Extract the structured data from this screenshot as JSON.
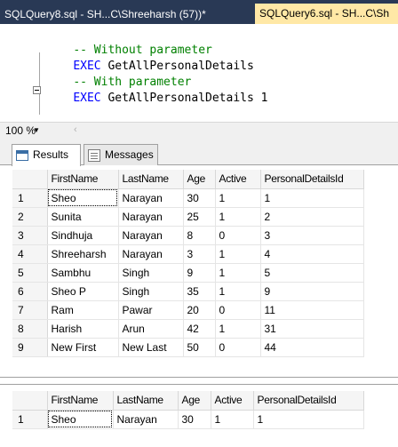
{
  "tabs": [
    {
      "label": "SQLQuery8.sql - SH...C\\Shreeharsh (57))*",
      "active": false
    },
    {
      "label": "SQLQuery6.sql - SH...C\\Sh",
      "active": true
    }
  ],
  "editor": {
    "lines": [
      {
        "keyword": "",
        "rest": "-- Without parameter",
        "comment": true
      },
      {
        "keyword": "EXEC",
        "rest": " GetAllPersonalDetails",
        "comment": false
      },
      {
        "keyword": "",
        "rest": "-- With parameter",
        "comment": true
      },
      {
        "keyword": "EXEC",
        "rest": " GetAllPersonalDetails 1",
        "comment": false
      }
    ]
  },
  "zoom": {
    "value": "100 %"
  },
  "result_tabs": [
    {
      "label": "Results"
    },
    {
      "label": "Messages"
    }
  ],
  "grid1": {
    "columns": [
      "FirstName",
      "LastName",
      "Age",
      "Active",
      "PersonalDetailsId"
    ],
    "rows": [
      [
        "1",
        "Sheo",
        "Narayan",
        "30",
        "1",
        "1"
      ],
      [
        "2",
        "Sunita",
        "Narayan",
        "25",
        "1",
        "2"
      ],
      [
        "3",
        "Sindhuja",
        "Narayan",
        "8",
        "0",
        "3"
      ],
      [
        "4",
        "Shreeharsh",
        "Narayan",
        "3",
        "1",
        "4"
      ],
      [
        "5",
        "Sambhu",
        "Singh",
        "9",
        "1",
        "5"
      ],
      [
        "6",
        "Sheo P",
        "Singh",
        "35",
        "1",
        "9"
      ],
      [
        "7",
        "Ram",
        "Pawar",
        "20",
        "0",
        "11"
      ],
      [
        "8",
        "Harish",
        "Arun",
        "42",
        "1",
        "31"
      ],
      [
        "9",
        "New First",
        "New Last",
        "50",
        "0",
        "44"
      ]
    ]
  },
  "grid2": {
    "columns": [
      "FirstName",
      "LastName",
      "Age",
      "Active",
      "PersonalDetailsId"
    ],
    "rows": [
      [
        "1",
        "Sheo",
        "Narayan",
        "30",
        "1",
        "1"
      ]
    ]
  },
  "colors": {
    "tabstrip_bg": "#293955",
    "active_tab_bg": "#ffe8a6",
    "keyword": "#0000ff",
    "comment": "#008000"
  },
  "icons": {
    "results": "grid-icon",
    "messages": "messages-icon",
    "collapse": "collapse-minus-icon"
  }
}
